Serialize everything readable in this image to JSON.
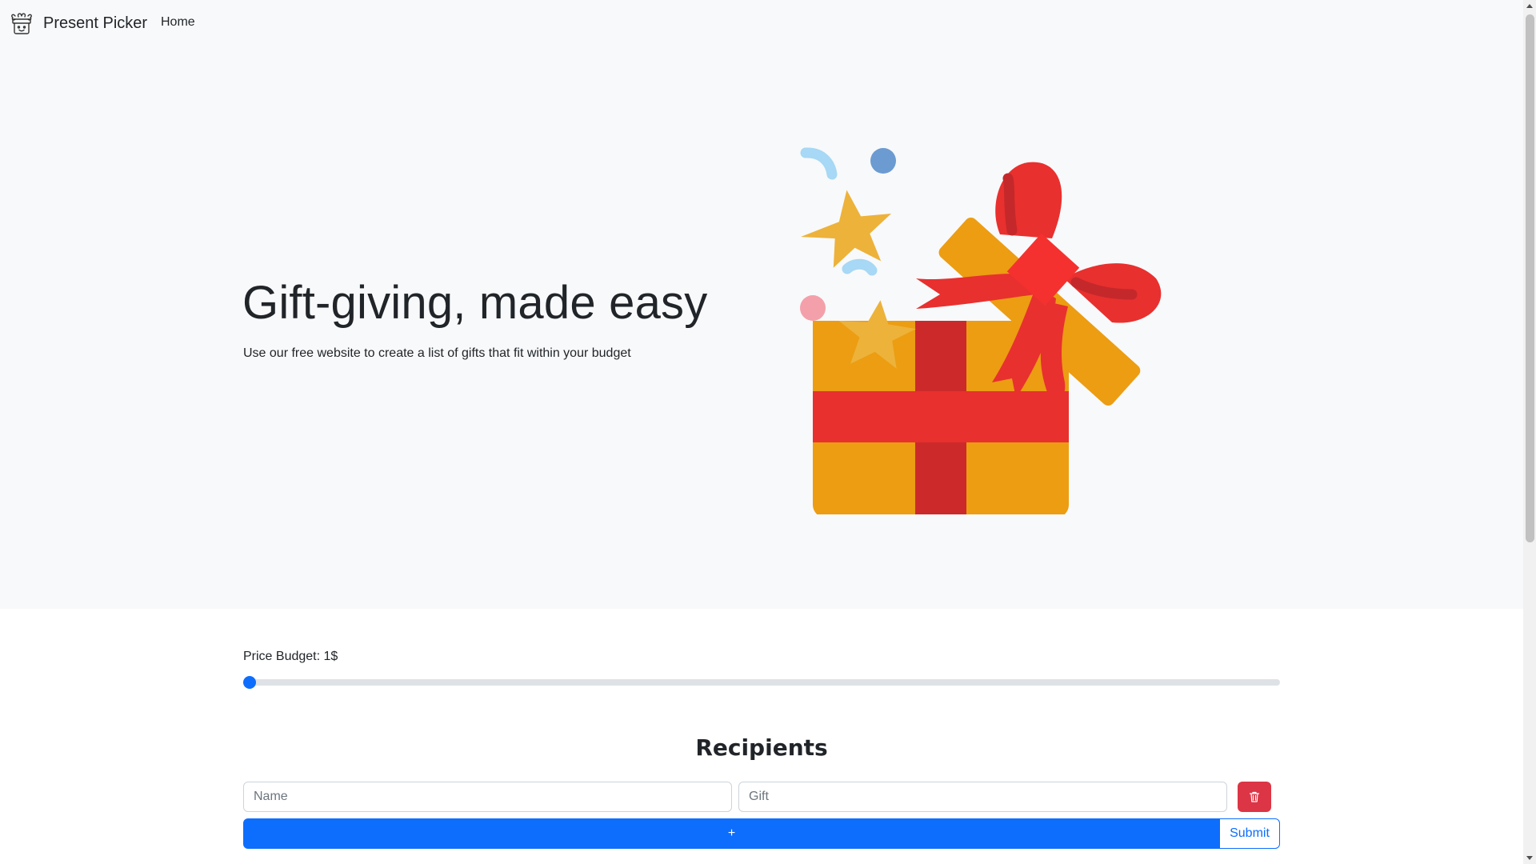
{
  "navbar": {
    "brand": "Present Picker",
    "brand_icon": "gift-box-face-icon",
    "links": [
      "Home"
    ]
  },
  "hero": {
    "title": "Gift-giving, made easy",
    "subtitle": "Use our free website to create a list of gifts that fit within your budget",
    "illustration": "open-gift-box-with-ribbon"
  },
  "budget": {
    "label": "Price Budget: 1$",
    "value_fraction": 0.0
  },
  "recipients": {
    "title": "Recipients",
    "name_placeholder": "Name",
    "gift_placeholder": "Gift",
    "delete_icon": "trash-icon",
    "add_label": "+",
    "submit_label": "Submit"
  },
  "colors": {
    "primary": "#0d6efd",
    "danger": "#dc3545",
    "hero_bg": "#f8f9fa"
  }
}
